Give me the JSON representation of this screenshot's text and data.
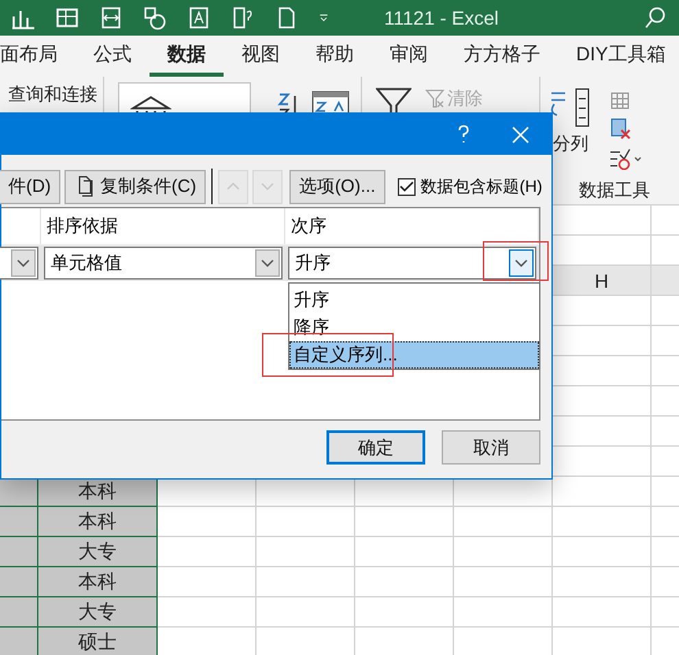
{
  "title_bar": {
    "title": "11121  -  Excel"
  },
  "ribbon_tabs": [
    {
      "label": "面布局",
      "selected": false
    },
    {
      "label": "公式",
      "selected": false
    },
    {
      "label": "数据",
      "selected": true
    },
    {
      "label": "视图",
      "selected": false
    },
    {
      "label": "帮助",
      "selected": false
    },
    {
      "label": "审阅",
      "selected": false
    },
    {
      "label": "方方格子",
      "selected": false
    },
    {
      "label": "DIY工具箱",
      "selected": false
    }
  ],
  "ribbon": {
    "query_label": "查询和连接",
    "clear_label": "清除",
    "clear_disabled": true,
    "split_label": "分列",
    "group_label": "数据工具"
  },
  "sheet": {
    "column_header": "H",
    "column_2_cells": [
      "本科",
      "本科",
      "大专",
      "本科",
      "大专",
      "硕士"
    ]
  },
  "dialog": {
    "toolbar": {
      "delete_button": "件(D)",
      "copy_button": "复制条件(C)",
      "move_up_disabled": true,
      "move_down_disabled": true,
      "options_button": "选项(O)...",
      "header_checkbox": {
        "label": "数据包含标题(H)",
        "checked": true
      }
    },
    "columns": [
      "排序依据",
      "次序"
    ],
    "row": {
      "sort_on": "单元格值",
      "order": "升序"
    },
    "order_options": [
      {
        "label": "升序",
        "selected": false
      },
      {
        "label": "降序",
        "selected": false
      },
      {
        "label": "自定义序列...",
        "selected": true
      }
    ],
    "ok_button": "确定",
    "cancel_button": "取消"
  }
}
